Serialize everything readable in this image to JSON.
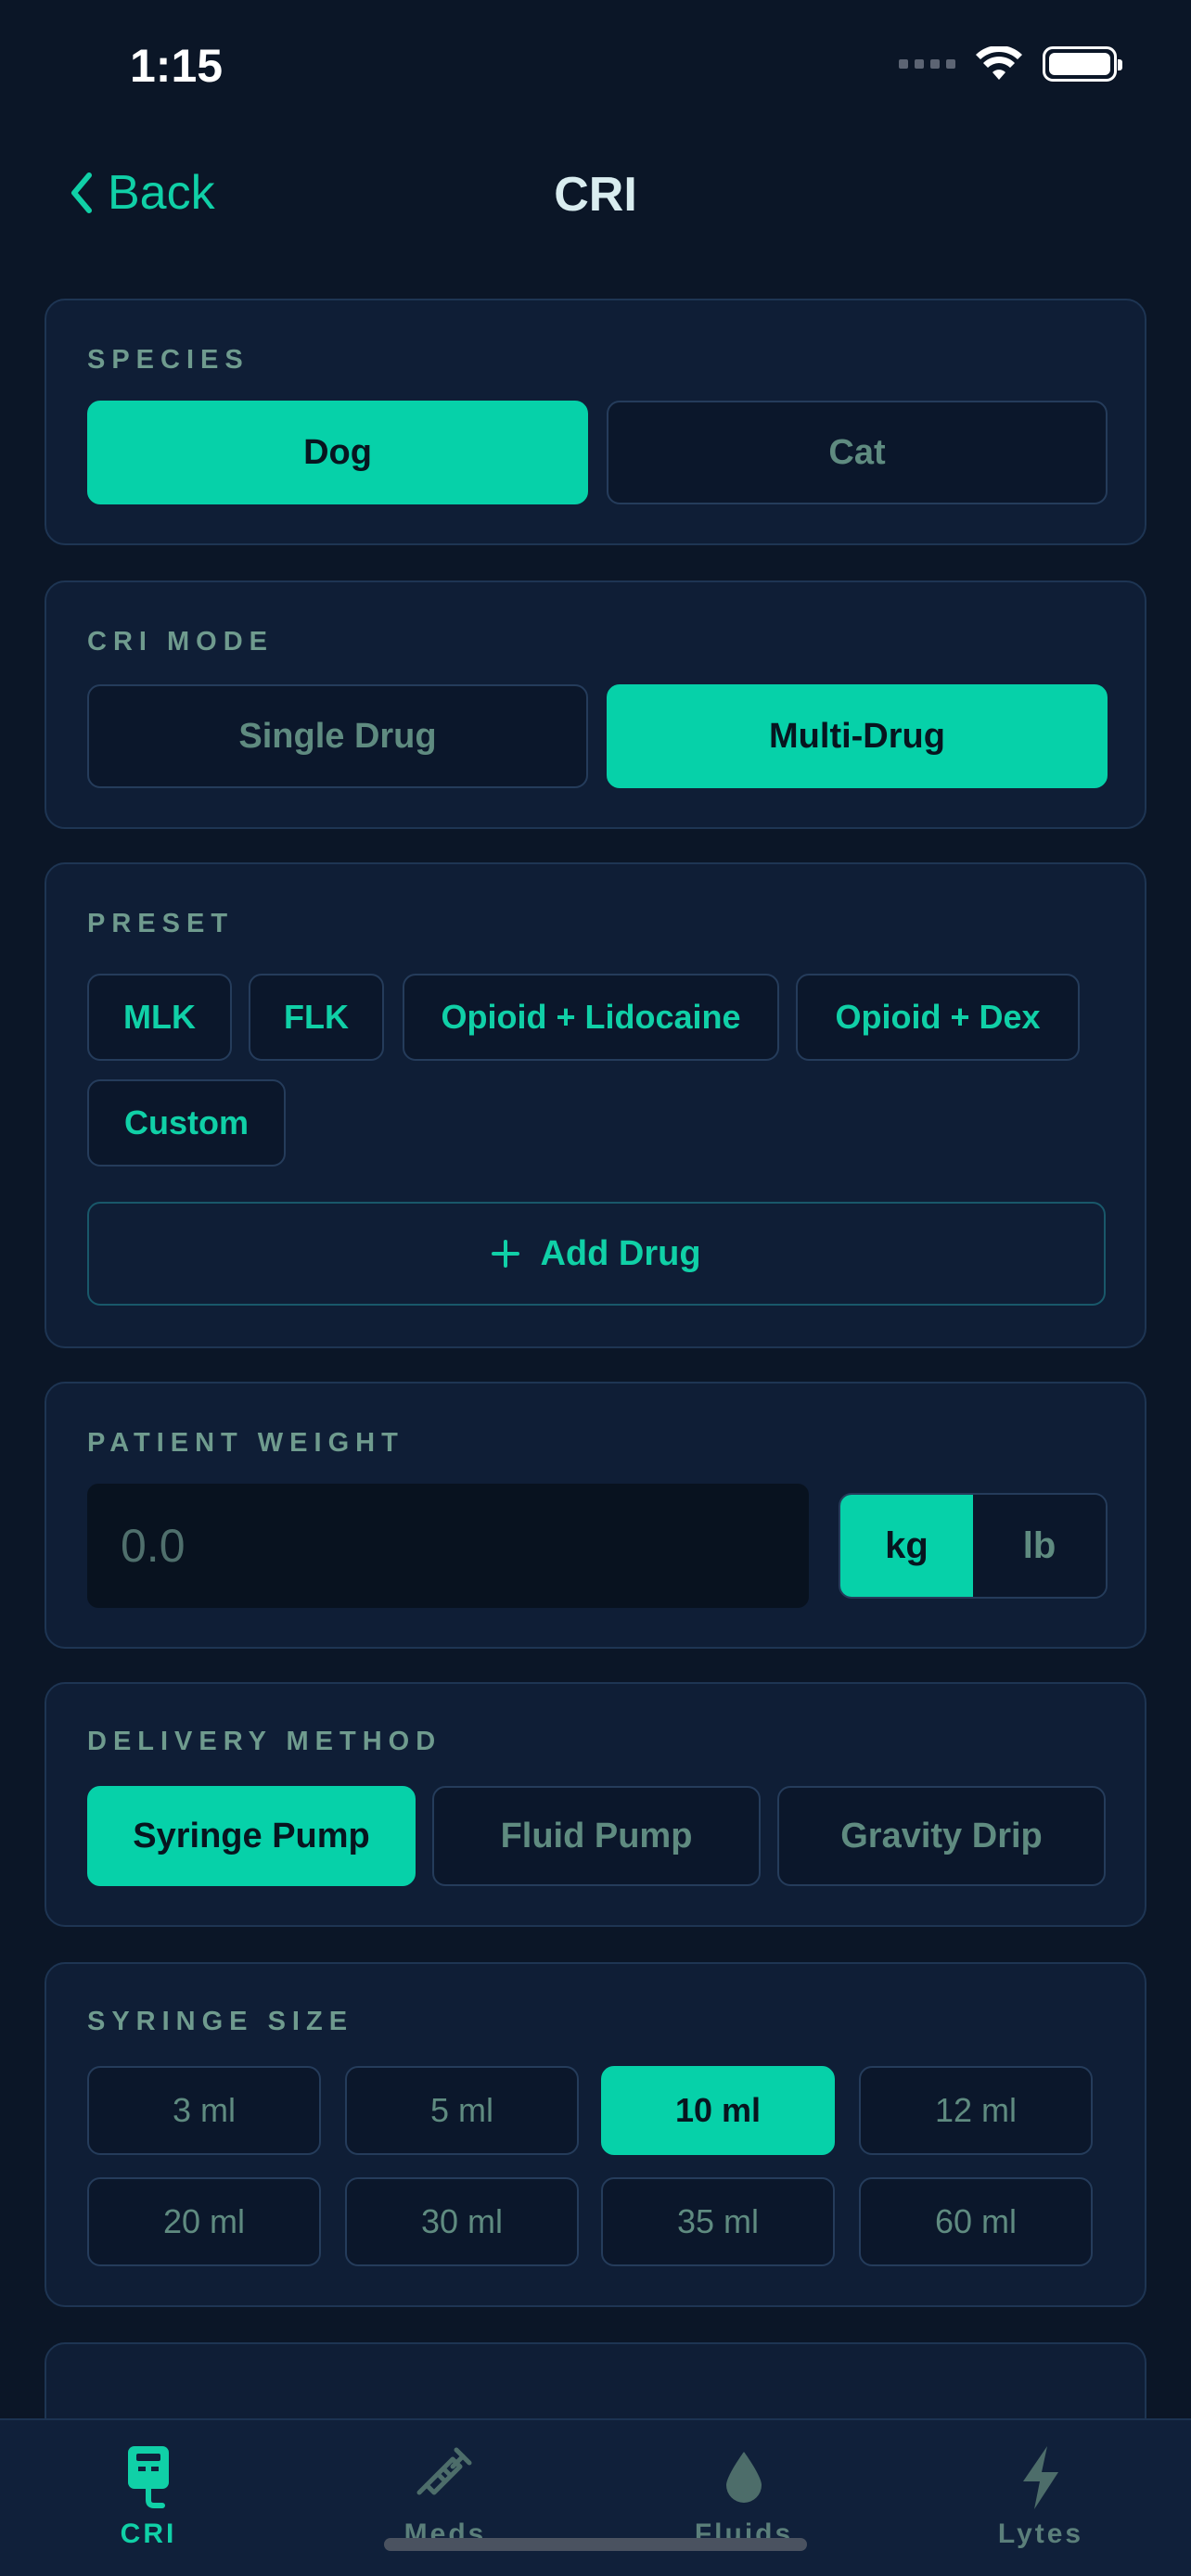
{
  "status_bar": {
    "time": "1:15"
  },
  "nav": {
    "back_label": "Back",
    "title": "CRI"
  },
  "species": {
    "label": "SPECIES",
    "options": [
      "Dog",
      "Cat"
    ],
    "selected": "Dog"
  },
  "cri_mode": {
    "label": "CRI MODE",
    "options": [
      "Single Drug",
      "Multi-Drug"
    ],
    "selected": "Multi-Drug"
  },
  "preset": {
    "label": "PRESET",
    "chips": [
      "MLK",
      "FLK",
      "Opioid + Lidocaine",
      "Opioid + Dex",
      "Custom"
    ],
    "add_drug_label": "Add Drug"
  },
  "patient_weight": {
    "label": "PATIENT WEIGHT",
    "placeholder": "0.0",
    "units": [
      "kg",
      "lb"
    ],
    "selected_unit": "kg"
  },
  "delivery_method": {
    "label": "DELIVERY METHOD",
    "options": [
      "Syringe Pump",
      "Fluid Pump",
      "Gravity Drip"
    ],
    "selected": "Syringe Pump"
  },
  "syringe_size": {
    "label": "SYRINGE SIZE",
    "options": [
      "3 ml",
      "5 ml",
      "10 ml",
      "12 ml",
      "20 ml",
      "30 ml",
      "35 ml",
      "60 ml"
    ],
    "selected": "10 ml"
  },
  "tab_bar": {
    "tabs": [
      {
        "label": "CRI",
        "icon": "iv-pump-icon",
        "active": true
      },
      {
        "label": "Meds",
        "icon": "syringe-icon",
        "active": false
      },
      {
        "label": "Fluids",
        "icon": "droplet-icon",
        "active": false
      },
      {
        "label": "Lytes",
        "icon": "bolt-icon",
        "active": false
      }
    ]
  },
  "colors": {
    "background": "#0b1627",
    "card": "#0f1e36",
    "accent": "#06d1a9",
    "muted_label": "#6f9b8e"
  }
}
